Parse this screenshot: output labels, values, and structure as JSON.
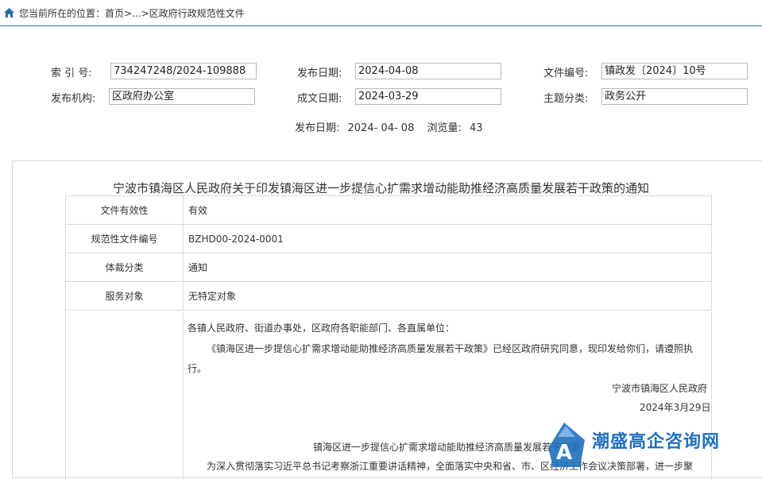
{
  "breadcrumb": {
    "prefix": "您当前所在的位置：",
    "home": "首页",
    "sep1": ">...>",
    "current": "区政府行政规范性文件"
  },
  "meta": {
    "index_label": "索 引 号:",
    "index_value": "734247248/2024-109888",
    "pubdate_label": "发布日期:",
    "pubdate_value": "2024-04-08",
    "docno_label": "文件编号:",
    "docno_value": "镇政发〔2024〕10号",
    "org_label": "发布机构:",
    "org_value": "区政府办公室",
    "created_label": "成文日期:",
    "created_value": "2024-03-29",
    "topic_label": "主题分类:",
    "topic_value": "政务公开",
    "line_pub_label": "发布日期:",
    "line_pub_value": "2024- 04- 08",
    "views_label": "浏览量:",
    "views_value": "43"
  },
  "article": {
    "title": "宁波市镇海区人民政府关于印发镇海区进一步提信心扩需求增动能助推经济高质量发展若干政策的通知",
    "rows": [
      {
        "key": "文件有效性",
        "value": "有效"
      },
      {
        "key": "规范性文件编号",
        "value": "BZHD00-2024-0001"
      },
      {
        "key": "体裁分类",
        "value": "通知"
      },
      {
        "key": "服务对象",
        "value": "无特定对象"
      }
    ],
    "salutation": "各镇人民政府、街道办事处，区政府各职能部门、各直属单位：",
    "para1": "《镇海区进一步提信心扩需求增动能助推经济高质量发展若干政策》已经区政府研究同意，现印发给你们，请遵照执",
    "para1_cont": "行。",
    "signer": "宁波市镇海区人民政府",
    "date": "2024年3月29日",
    "subtitle": "镇海区进一步提信心扩需求增动能助推经济高质量发展若干政策",
    "next_line": "为深入贯彻落实习近平总书记考察浙江重要讲话精神，全面落实中央和省、市、区经济工作会议决策部署，进一步聚"
  },
  "watermark": {
    "text": "潮盛高企咨询网",
    "color": "#1f6fbf"
  }
}
